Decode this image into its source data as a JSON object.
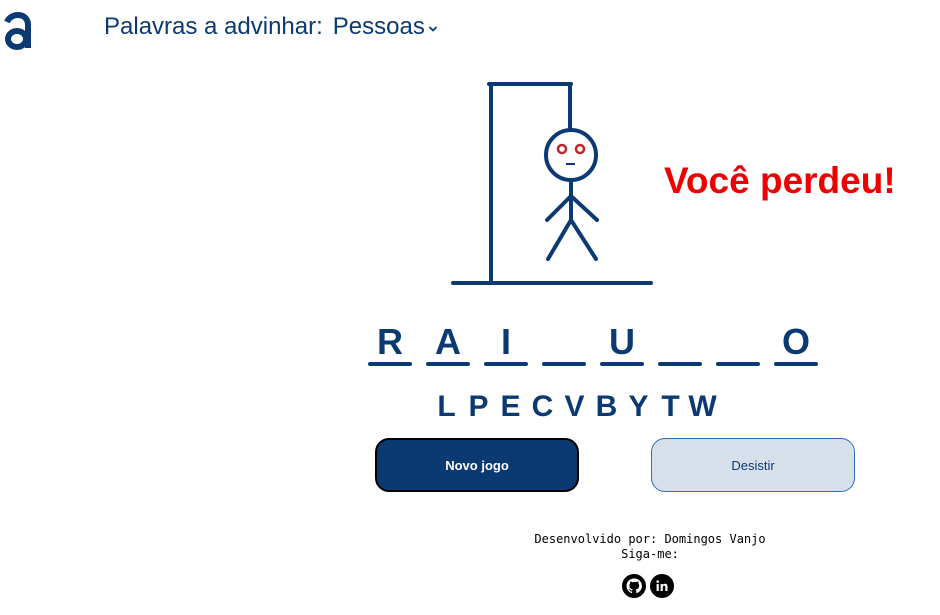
{
  "header": {
    "label": "Palavras a advinhar:",
    "category": "Pessoas"
  },
  "game": {
    "status": "Você perdeu!",
    "word_slots": [
      "R",
      "A",
      "I",
      "",
      "U",
      "",
      "",
      "O"
    ],
    "wrong_letters": [
      "L",
      "P",
      "E",
      "C",
      "V",
      "B",
      "Y",
      "T",
      "W"
    ]
  },
  "buttons": {
    "new_game": "Novo jogo",
    "give_up": "Desistir"
  },
  "footer": {
    "developed_by": "Desenvolvido por: Domingos Vanjo",
    "follow": "Siga-me:"
  },
  "icons": {
    "logo": "brand-a-logo",
    "category_dropdown": "chevron-down-icon",
    "github": "github-icon",
    "linkedin": "linkedin-icon"
  },
  "colors": {
    "primary": "#0b3a73",
    "lost": "#ee0000",
    "secondary_button": "#d6dfea",
    "eyes": "#c0272d"
  }
}
